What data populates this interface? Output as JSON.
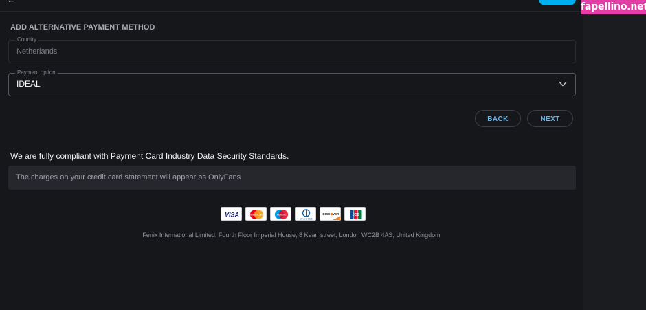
{
  "header": {
    "back_arrow": "arrow-left-icon"
  },
  "watermark": "fapellino.net",
  "form": {
    "title": "ADD ALTERNATIVE PAYMENT METHOD",
    "country": {
      "label": "Country",
      "value": "Netherlands"
    },
    "payment_option": {
      "label": "Payment option",
      "value": "IDEAL"
    },
    "buttons": {
      "back": "BACK",
      "next": "NEXT"
    }
  },
  "info": {
    "compliance": "We are fully compliant with Payment Card Industry Data Security Standards.",
    "charges": "The charges on your credit card statement will appear as OnlyFans"
  },
  "card_logos": [
    "VISA",
    "MasterCard",
    "Maestro",
    "Diners Club",
    "DISCOVER",
    "JCB"
  ],
  "footer": "Fenix International Limited, Fourth Floor Imperial House, 8 Kean street, London WC2B 4AS, United Kingdom",
  "colors": {
    "background": "#16171b",
    "accent": "#00aff0",
    "button_text": "#5fb8f4",
    "watermark_bg": "#e23ea6"
  }
}
